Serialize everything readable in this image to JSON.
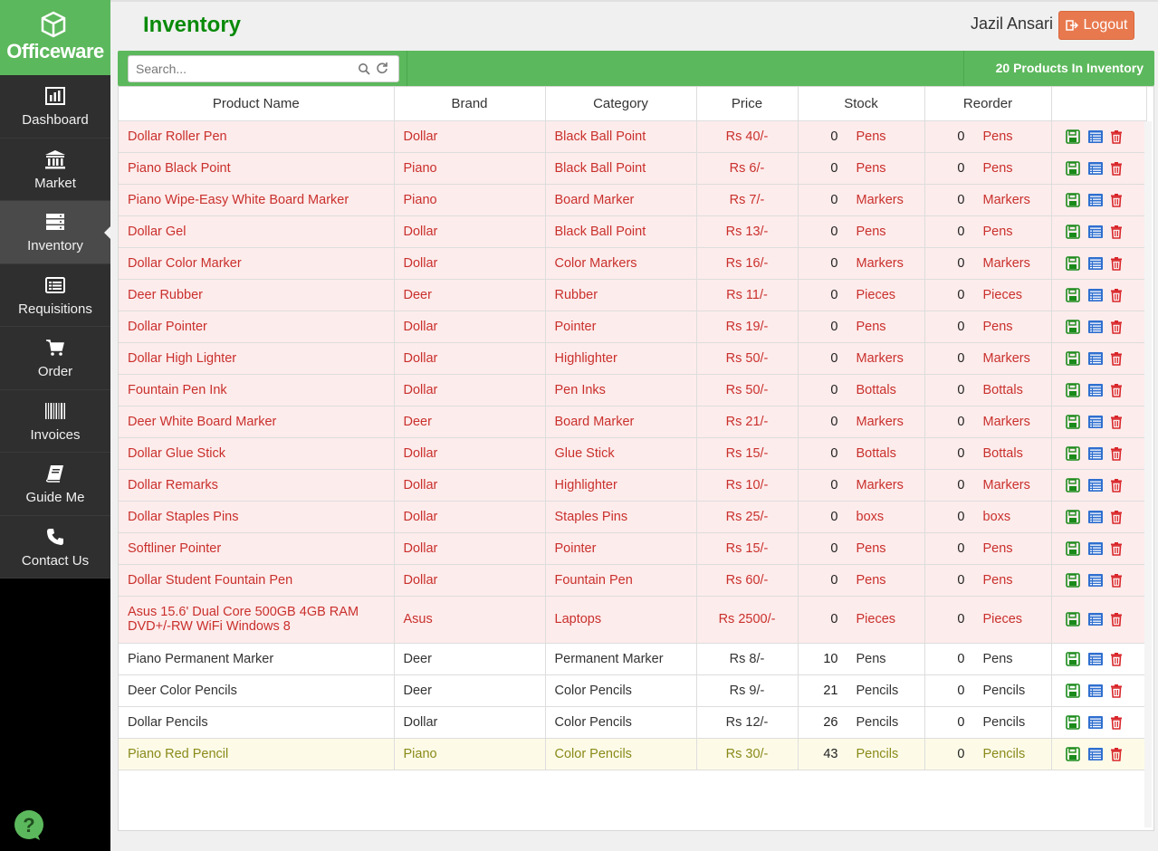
{
  "brand": {
    "name": "Officeware"
  },
  "sidebar": {
    "items": [
      {
        "label": "Dashboard",
        "icon": "bar-chart-icon"
      },
      {
        "label": "Market",
        "icon": "bank-icon"
      },
      {
        "label": "Inventory",
        "icon": "server-icon",
        "active": true
      },
      {
        "label": "Requisitions",
        "icon": "list-icon"
      },
      {
        "label": "Order",
        "icon": "cart-icon"
      },
      {
        "label": "Invoices",
        "icon": "barcode-icon"
      },
      {
        "label": "Guide Me",
        "icon": "book-icon"
      },
      {
        "label": "Contact Us",
        "icon": "phone-icon"
      }
    ]
  },
  "header": {
    "title": "Inventory",
    "user": "Jazil Ansari",
    "logout_label": "Logout"
  },
  "toolbar": {
    "search_placeholder": "Search...",
    "count_text": "20 Products In Inventory"
  },
  "table": {
    "headers": [
      "Product Name",
      "Brand",
      "Category",
      "Price",
      "Stock",
      "Reorder"
    ],
    "rows": [
      {
        "name": "Dollar Roller Pen",
        "brand": "Dollar",
        "category": "Black Ball Point",
        "price": "Rs 40/-",
        "stock": "0",
        "stock_unit": "Pens",
        "reorder": "0",
        "reorder_unit": "Pens",
        "status": "low"
      },
      {
        "name": "Piano Black Point",
        "brand": "Piano",
        "category": "Black Ball Point",
        "price": "Rs 6/-",
        "stock": "0",
        "stock_unit": "Pens",
        "reorder": "0",
        "reorder_unit": "Pens",
        "status": "low"
      },
      {
        "name": "Piano Wipe-Easy White Board Marker",
        "brand": "Piano",
        "category": "Board Marker",
        "price": "Rs 7/-",
        "stock": "0",
        "stock_unit": "Markers",
        "reorder": "0",
        "reorder_unit": "Markers",
        "status": "low"
      },
      {
        "name": "Dollar Gel",
        "brand": "Dollar",
        "category": "Black Ball Point",
        "price": "Rs 13/-",
        "stock": "0",
        "stock_unit": "Pens",
        "reorder": "0",
        "reorder_unit": "Pens",
        "status": "low"
      },
      {
        "name": "Dollar Color Marker",
        "brand": "Dollar",
        "category": "Color Markers",
        "price": "Rs 16/-",
        "stock": "0",
        "stock_unit": "Markers",
        "reorder": "0",
        "reorder_unit": "Markers",
        "status": "low"
      },
      {
        "name": "Deer Rubber",
        "brand": "Deer",
        "category": "Rubber",
        "price": "Rs 11/-",
        "stock": "0",
        "stock_unit": "Pieces",
        "reorder": "0",
        "reorder_unit": "Pieces",
        "status": "low"
      },
      {
        "name": "Dollar Pointer",
        "brand": "Dollar",
        "category": "Pointer",
        "price": "Rs 19/-",
        "stock": "0",
        "stock_unit": "Pens",
        "reorder": "0",
        "reorder_unit": "Pens",
        "status": "low"
      },
      {
        "name": "Dollar High Lighter",
        "brand": "Dollar",
        "category": "Highlighter",
        "price": "Rs 50/-",
        "stock": "0",
        "stock_unit": "Markers",
        "reorder": "0",
        "reorder_unit": "Markers",
        "status": "low"
      },
      {
        "name": "Fountain Pen Ink",
        "brand": "Dollar",
        "category": "Pen Inks",
        "price": "Rs 50/-",
        "stock": "0",
        "stock_unit": "Bottals",
        "reorder": "0",
        "reorder_unit": "Bottals",
        "status": "low"
      },
      {
        "name": "Deer White Board Marker",
        "brand": "Deer",
        "category": "Board Marker",
        "price": "Rs 21/-",
        "stock": "0",
        "stock_unit": "Markers",
        "reorder": "0",
        "reorder_unit": "Markers",
        "status": "low"
      },
      {
        "name": "Dollar Glue Stick",
        "brand": "Dollar",
        "category": "Glue Stick",
        "price": "Rs 15/-",
        "stock": "0",
        "stock_unit": "Bottals",
        "reorder": "0",
        "reorder_unit": "Bottals",
        "status": "low"
      },
      {
        "name": "Dollar Remarks",
        "brand": "Dollar",
        "category": "Highlighter",
        "price": "Rs 10/-",
        "stock": "0",
        "stock_unit": "Markers",
        "reorder": "0",
        "reorder_unit": "Markers",
        "status": "low"
      },
      {
        "name": "Dollar Staples Pins",
        "brand": "Dollar",
        "category": "Staples Pins",
        "price": "Rs 25/-",
        "stock": "0",
        "stock_unit": "boxs",
        "reorder": "0",
        "reorder_unit": "boxs",
        "status": "low"
      },
      {
        "name": "Softliner Pointer",
        "brand": "Dollar",
        "category": "Pointer",
        "price": "Rs 15/-",
        "stock": "0",
        "stock_unit": "Pens",
        "reorder": "0",
        "reorder_unit": "Pens",
        "status": "low"
      },
      {
        "name": "Dollar Student Fountain Pen",
        "brand": "Dollar",
        "category": "Fountain Pen",
        "price": "Rs 60/-",
        "stock": "0",
        "stock_unit": "Pens",
        "reorder": "0",
        "reorder_unit": "Pens",
        "status": "low"
      },
      {
        "name": "Asus 15.6' Dual Core 500GB 4GB RAM DVD+/-RW WiFi Windows 8",
        "brand": "Asus",
        "category": "Laptops",
        "price": "Rs 2500/-",
        "stock": "0",
        "stock_unit": "Pieces",
        "reorder": "0",
        "reorder_unit": "Pieces",
        "status": "low",
        "tall": true
      },
      {
        "name": "Piano Permanent Marker",
        "brand": "Deer",
        "category": "Permanent Marker",
        "price": "Rs 8/-",
        "stock": "10",
        "stock_unit": "Pens",
        "reorder": "0",
        "reorder_unit": "Pens",
        "status": "ok"
      },
      {
        "name": "Deer Color Pencils",
        "brand": "Deer",
        "category": "Color Pencils",
        "price": "Rs 9/-",
        "stock": "21",
        "stock_unit": "Pencils",
        "reorder": "0",
        "reorder_unit": "Pencils",
        "status": "ok"
      },
      {
        "name": "Dollar Pencils",
        "brand": "Dollar",
        "category": "Color Pencils",
        "price": "Rs 12/-",
        "stock": "26",
        "stock_unit": "Pencils",
        "reorder": "0",
        "reorder_unit": "Pencils",
        "status": "ok"
      },
      {
        "name": "Piano Red Pencil",
        "brand": "Piano",
        "category": "Color Pencils",
        "price": "Rs 30/-",
        "stock": "43",
        "stock_unit": "Pencils",
        "reorder": "0",
        "reorder_unit": "Pencils",
        "status": "warn"
      }
    ]
  },
  "colors": {
    "brand_green": "#5cb85c",
    "title_green": "#0a8a0a",
    "logout": "#e8794e",
    "low_text": "#c9302c",
    "low_bg": "#fdecec"
  }
}
